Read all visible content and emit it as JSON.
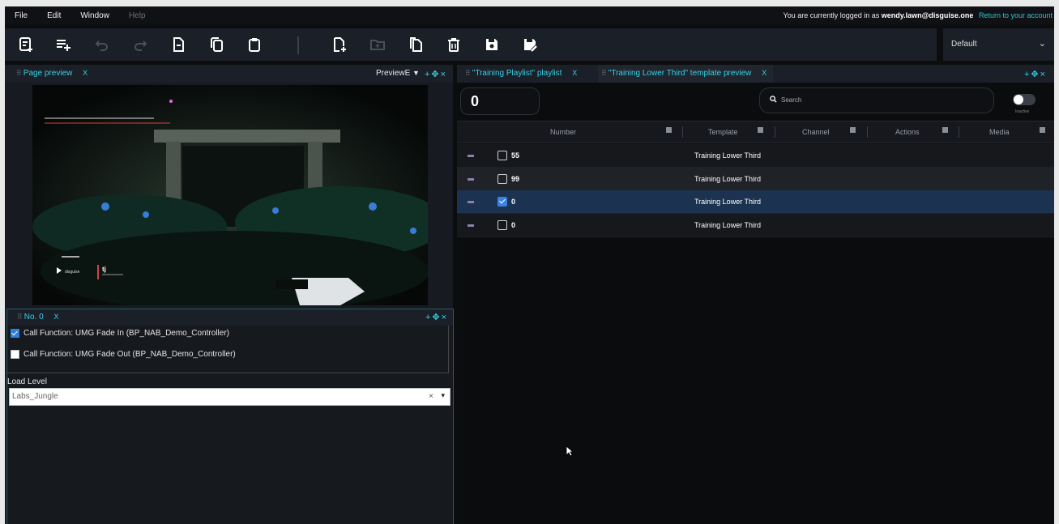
{
  "menu": {
    "file": "File",
    "edit": "Edit",
    "window": "Window",
    "help": "Help"
  },
  "login": {
    "prefix": "You are currently logged in as",
    "user": "wendy.lawn@disguise.one",
    "link": "Return to your account"
  },
  "preset": {
    "label": "Default"
  },
  "page_preview": {
    "title": "Page preview",
    "close": "X",
    "view_label": "PreviewE"
  },
  "preview_overlay": {
    "brand": "disguise",
    "tag": "tj"
  },
  "tabs": [
    {
      "title": "\"Training Playlist\" playlist",
      "close": "X"
    },
    {
      "title": "\"Training Lower Third\" template preview",
      "close": "X"
    }
  ],
  "no_panel": {
    "title": "No. 0",
    "close": "X",
    "functions": [
      {
        "label": "Call Function: UMG Fade In (BP_NAB_Demo_Controller)",
        "checked": true
      },
      {
        "label": "Call Function: UMG Fade Out (BP_NAB_Demo_Controller)",
        "checked": false
      }
    ],
    "load_level_label": "Load Level",
    "load_level_value": "Labs_Jungle",
    "clear": "×",
    "dropdown": "▾"
  },
  "playlist": {
    "counter": "0",
    "search_placeholder": "Search",
    "toggle_label": "Inactive",
    "columns": [
      "Number",
      "Template",
      "Channel",
      "Actions",
      "Media"
    ],
    "rows": [
      {
        "number": "55",
        "template": "Training Lower Third",
        "checked": false
      },
      {
        "number": "99",
        "template": "Training Lower Third",
        "checked": false
      },
      {
        "number": "0",
        "template": "Training Lower Third",
        "checked": true
      },
      {
        "number": "0",
        "template": "Training Lower Third",
        "checked": false
      }
    ]
  }
}
